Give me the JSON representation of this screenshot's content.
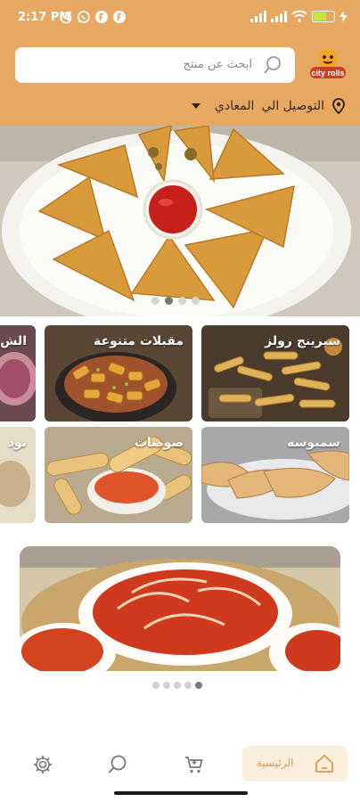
{
  "status_bar": {
    "time": "2:17 PM",
    "left_icons": [
      "alarm-icon",
      "whatsapp-icon",
      "app-f-icon",
      "app-f-icon"
    ],
    "right_icons": [
      "signal-icon",
      "signal-icon",
      "wifi-icon",
      "battery-icon",
      "charging-icon"
    ]
  },
  "header": {
    "logo_text": "city rolls",
    "search": {
      "placeholder": "ابحث عن منتج"
    },
    "delivery": {
      "label": "التوصيل الي",
      "area": "المعادي"
    }
  },
  "banner": {
    "image": "samosa-plate",
    "slides_count": 4,
    "active_slide": 1
  },
  "categories": [
    {
      "title": "سبرينج رولز",
      "image": "spring-rolls"
    },
    {
      "title": "مقبلات متنوعة",
      "image": "appetizers"
    },
    {
      "title": "الش",
      "image": "partial-card"
    },
    {
      "title": "سمبوسه",
      "image": "samosa"
    },
    {
      "title": "صوصات",
      "image": "sauces"
    },
    {
      "title": "نود",
      "image": "partial-card"
    }
  ],
  "promo": {
    "image": "kimchi-plates",
    "slides_count": 5,
    "active_slide": 4
  },
  "bottom_nav": {
    "items": [
      {
        "icon": "settings-icon"
      },
      {
        "icon": "search-icon"
      },
      {
        "icon": "cart-icon"
      },
      {
        "icon": "home-icon",
        "label": "الرئيسية",
        "active": true
      }
    ]
  },
  "colors": {
    "brand": "#e6a862",
    "home_active_bg": "#fbeedd",
    "home_active_text": "#d99a52"
  }
}
